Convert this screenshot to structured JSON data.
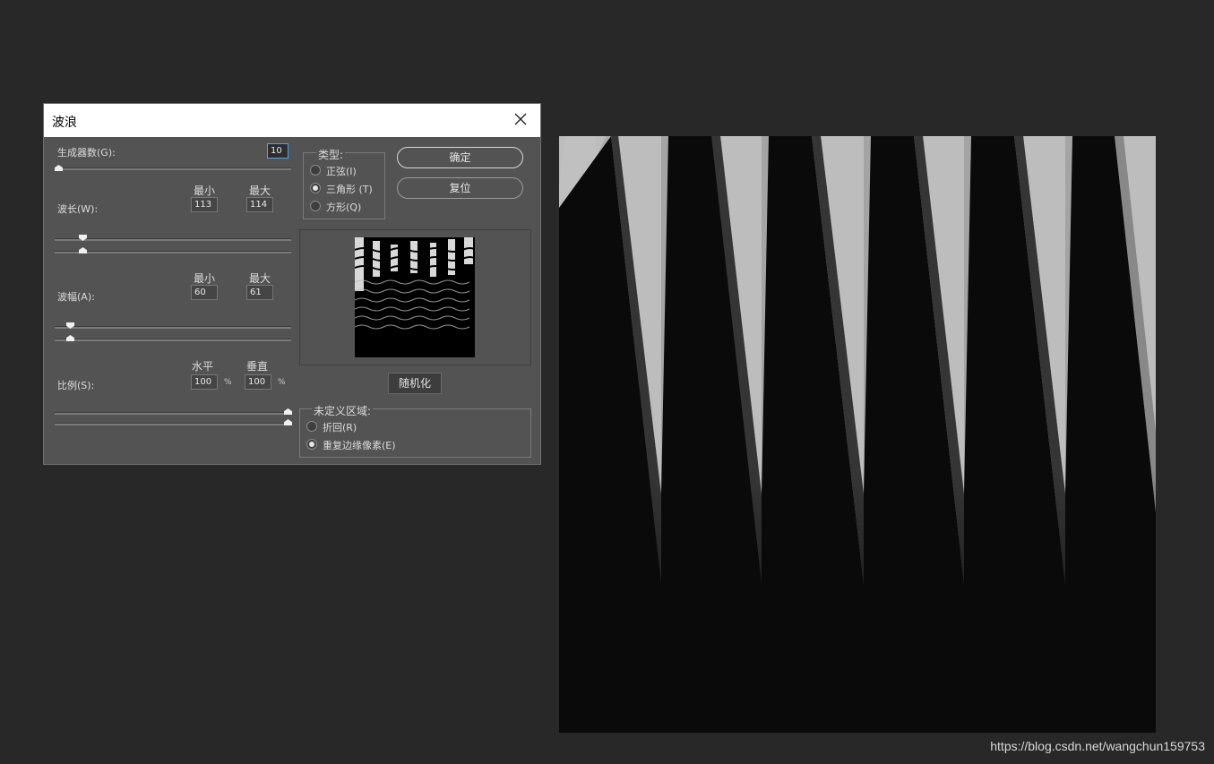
{
  "dialog": {
    "title": "波浪",
    "generators": {
      "label": "生成器数(G):",
      "value": "10"
    },
    "min_header": "最小",
    "max_header": "最大",
    "wavelength": {
      "label": "波长(W):",
      "min": "113",
      "max": "114"
    },
    "amplitude": {
      "label": "波幅(A):",
      "min": "60",
      "max": "61"
    },
    "scale": {
      "label": "比例(S):",
      "horizontal_header": "水平",
      "vertical_header": "垂直",
      "horizontal": "100",
      "vertical": "100",
      "unit": "%"
    },
    "type_group": {
      "title": "类型:",
      "options": [
        {
          "label": "正弦(I)",
          "selected": false
        },
        {
          "label": "三角形 (T)",
          "selected": true
        },
        {
          "label": "方形(Q)",
          "selected": false
        }
      ]
    },
    "ok_label": "确定",
    "reset_label": "复位",
    "randomize_label": "随机化",
    "undefined_group": {
      "title": "未定义区域:",
      "options": [
        {
          "label": "折回(R)",
          "selected": false
        },
        {
          "label": "重复边缘像素(E)",
          "selected": true
        }
      ]
    }
  },
  "watermark": "https://blog.csdn.net/wangchun159753",
  "colors": {
    "background": "#282828",
    "dialog": "#535353",
    "titlebar": "#ffffff",
    "canvas_light": "#bdbdbd",
    "canvas_dark": "#1e1e1e"
  }
}
